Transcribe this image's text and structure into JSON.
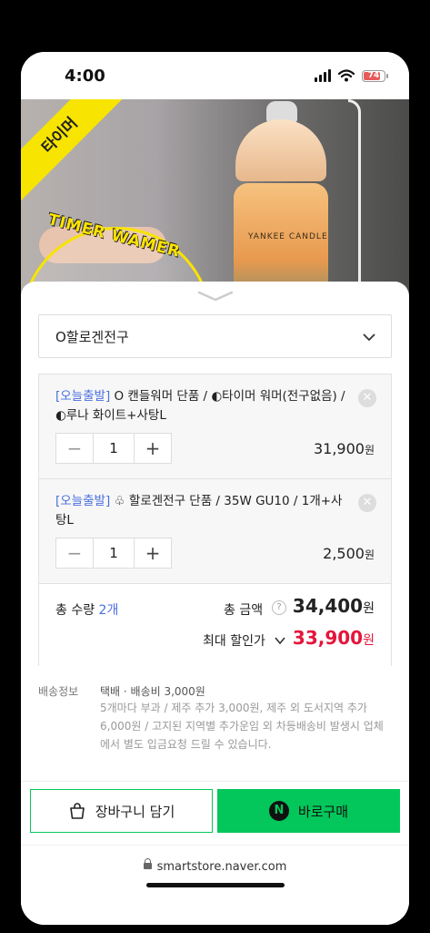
{
  "status_bar": {
    "time": "4:00",
    "battery": "74"
  },
  "hero": {
    "ribbon_text": "타이머",
    "badge_text": "TIMER WAMER",
    "jar_label": "YANKEE CANDLE"
  },
  "option_select": {
    "value": "O할로겐전구"
  },
  "cart": {
    "items": [
      {
        "tag": "[오늘출발]",
        "name": "O 캔들워머 단품 / ◐타이머 워머(전구없음) / ◐루나 화이트+사탕L",
        "qty": "1",
        "price": "31,900",
        "unit": "원"
      },
      {
        "tag": "[오늘출발]",
        "name": "♧ 할로겐전구 단품 / 35W GU10 / 1개+사탕L",
        "qty": "1",
        "price": "2,500",
        "unit": "원"
      }
    ],
    "total_qty_label": "총 수량",
    "total_qty_value": "2개",
    "total_amount_label": "총 금액",
    "total_amount": "34,400",
    "max_discount_label": "최대 할인가",
    "max_discount_amount": "33,900",
    "unit": "원"
  },
  "shipping": {
    "label": "배송정보",
    "main": "택배 · 배송비 3,000원",
    "note": "5개마다 부과 / 제주 추가 3,000원, 제주 외 도서지역 추가 6,000원 / 고지된 지역별 추가운임 외 차등배송비 발생시 업체에서 별도 입금요청 드릴 수 있습니다."
  },
  "actions": {
    "add_to_cart": "장바구니 담기",
    "buy_now": "바로구매",
    "naver_mark": "N"
  },
  "browser": {
    "url": "smartstore.naver.com"
  },
  "colors": {
    "naver_green": "#03c75a",
    "discount_red": "#e4153b",
    "tag_blue": "#4a6ee0"
  }
}
